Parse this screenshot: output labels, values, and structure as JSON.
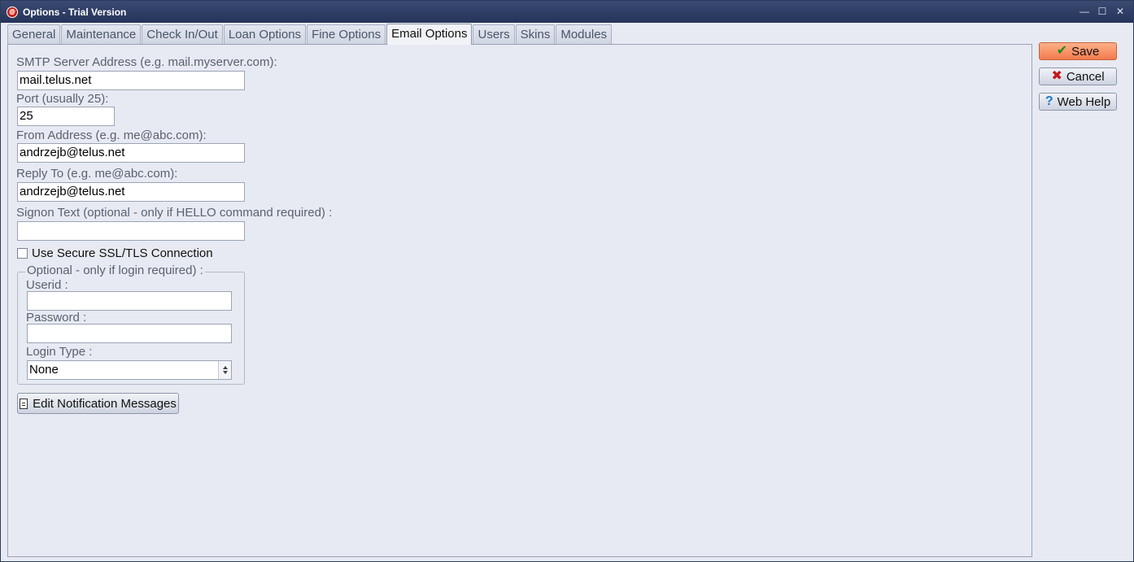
{
  "window": {
    "title": "Options - Trial Version",
    "controls": [
      "minimize",
      "maximize",
      "close"
    ]
  },
  "tabs": [
    {
      "label": "General"
    },
    {
      "label": "Maintenance"
    },
    {
      "label": "Check In/Out"
    },
    {
      "label": "Loan Options"
    },
    {
      "label": "Fine Options"
    },
    {
      "label": "Email Options",
      "active": true
    },
    {
      "label": "Users"
    },
    {
      "label": "Skins"
    },
    {
      "label": "Modules"
    }
  ],
  "form": {
    "smtp_label": "SMTP Server Address (e.g. mail.myserver.com):",
    "smtp_value": "mail.telus.net",
    "port_label": "Port (usually 25):",
    "port_value": "25",
    "from_label": "From Address (e.g. me@abc.com):",
    "from_value": "andrzejb@telus.net",
    "reply_label": "Reply To (e.g. me@abc.com):",
    "reply_value": "andrzejb@telus.net",
    "signon_label": "Signon Text (optional - only if HELLO command required) :",
    "signon_value": "",
    "ssl_label": "Use Secure SSL/TLS Connection",
    "ssl_checked": false,
    "login_group": {
      "legend": "Optional - only if login required) :",
      "userid_label": "Userid :",
      "userid_value": "",
      "password_label": "Password :",
      "password_value": "",
      "login_type_label": "Login Type :",
      "login_type_value": "None"
    },
    "edit_messages_label": "Edit Notification Messages"
  },
  "actions": {
    "save_label": "Save",
    "cancel_label": "Cancel",
    "help_label": "Web Help"
  },
  "colors": {
    "titlebar": "#26345a",
    "panel_bg": "#e7eaf2",
    "save_button": "#f27a4c"
  }
}
